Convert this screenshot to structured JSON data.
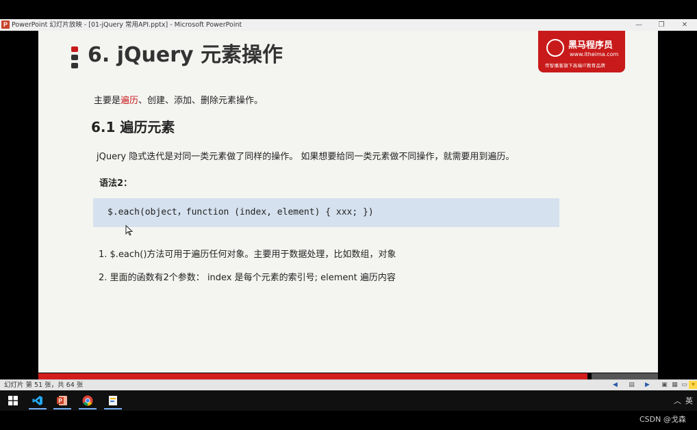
{
  "window": {
    "app_icon_letter": "P",
    "title": "PowerPoint 幻灯片放映 - [01-jQuery 常用API.pptx] - Microsoft PowerPoint",
    "min": "—",
    "restore": "❐",
    "close": "✕"
  },
  "slide": {
    "title": "6. jQuery 元素操作",
    "logo": {
      "name": "黑马程序员",
      "url": "www.itheima.com",
      "slogan": "传智播客旗下高端IT教育品牌"
    },
    "intro_prefix": "主要是",
    "intro_highlight": "遍历",
    "intro_suffix": "、创建、添加、删除元素操作。",
    "section_heading": "6.1 遍历元素",
    "description": "jQuery 隐式迭代是对同一类元素做了同样的操作。 如果想要给同一类元素做不同操作，就需要用到遍历。",
    "syntax_label": "语法2：",
    "code": "$.each(object，function (index, element) { xxx; })",
    "points": [
      "1. $.each()方法可用于遍历任何对象。主要用于数据处理，比如数组，对象",
      "2. 里面的函数有2个参数： index 是每个元素的索引号; element  遍历内容"
    ]
  },
  "status": {
    "slide_counter": "幻灯片 第 51 张，共 64 张"
  },
  "taskbar": {
    "apps": [
      "vscode-icon",
      "powerpoint-icon",
      "chrome-icon",
      "file-icon"
    ],
    "ime": "英",
    "tray_chevron": "︿"
  },
  "watermark": "CSDN @戈森",
  "colors": {
    "accent_red": "#c81a1a",
    "code_bg": "#d5e1ee",
    "slide_bg": "#f4f4f1"
  }
}
